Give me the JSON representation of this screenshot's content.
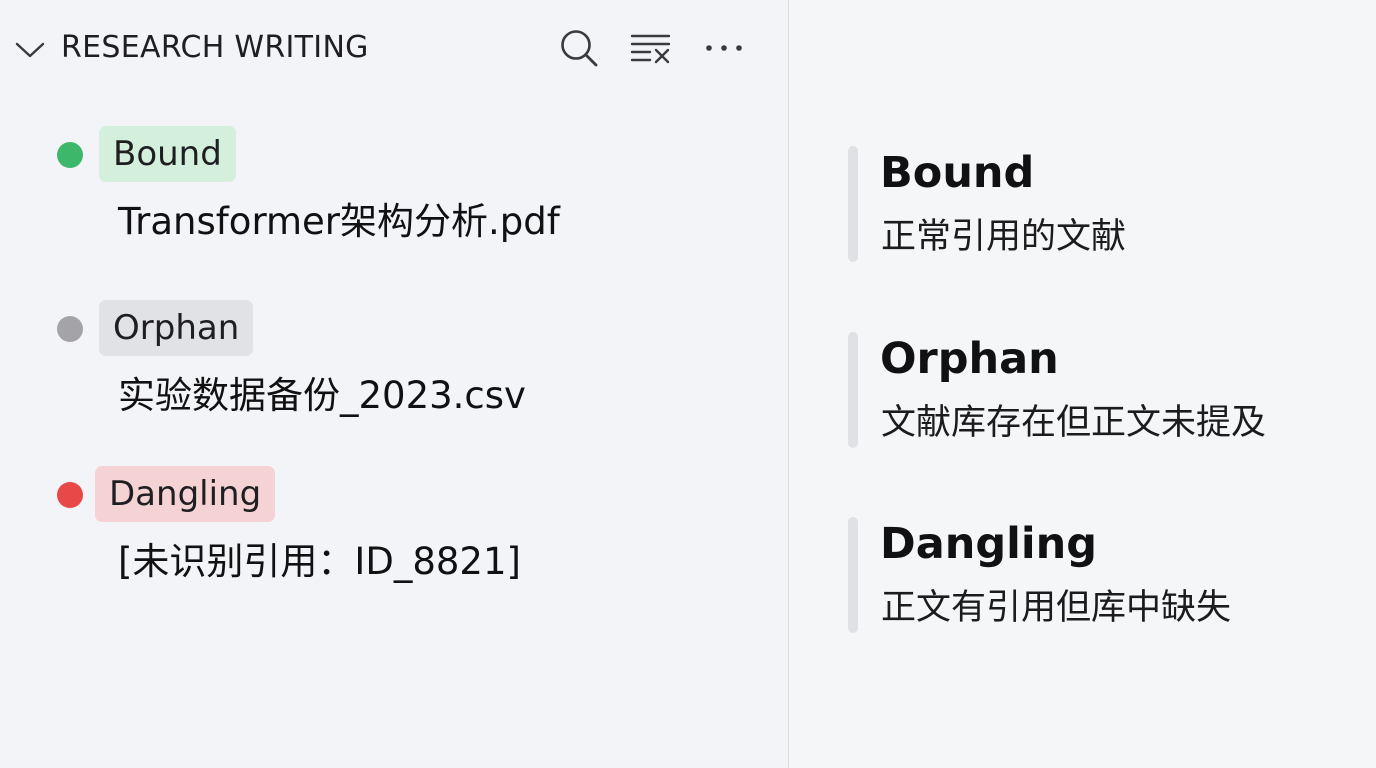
{
  "section": {
    "title": "RESEARCH WRITING",
    "toolbar": {
      "search_icon": "search-icon",
      "clear_filter_icon": "clear-filter-icon",
      "more_icon": "more-icon"
    }
  },
  "items": [
    {
      "status": "Bound",
      "filename": "Transformer架构分析.pdf",
      "dot_color": "#3db86b",
      "badge_bg": "#d4efdc"
    },
    {
      "status": "Orphan",
      "filename": "实验数据备份_2023.csv",
      "dot_color": "#a4a4a8",
      "badge_bg": "#e1e2e5"
    },
    {
      "status": "Dangling",
      "filename": "[未识别引用：ID_8821]",
      "dot_color": "#e84848",
      "badge_bg": "#f5d3d5"
    }
  ],
  "legend": [
    {
      "title": "Bound",
      "description": "正常引用的文献"
    },
    {
      "title": "Orphan",
      "description": "文献库存在但正文未提及"
    },
    {
      "title": "Dangling",
      "description": "正文有引用但库中缺失"
    }
  ],
  "colors": {
    "bound": "#3db86b",
    "orphan": "#a4a4a8",
    "dangling": "#e84848",
    "panel_bg": "#f3f4f7",
    "divider": "#dcdde1"
  }
}
